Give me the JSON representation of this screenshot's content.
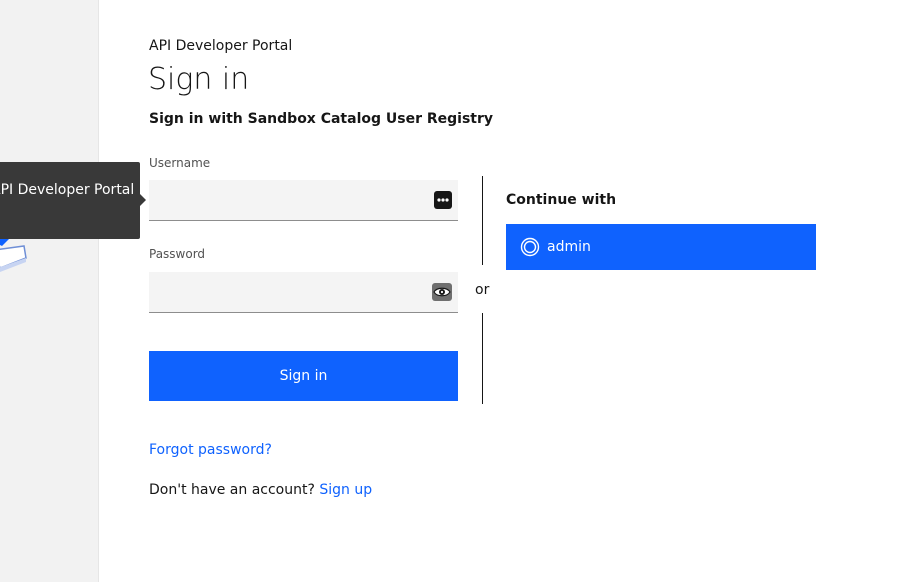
{
  "tooltip": {
    "text": "API Developer Portal"
  },
  "header": {
    "portal_label": "API Developer Portal",
    "title": "Sign in",
    "subtitle": "Sign in with Sandbox Catalog User Registry"
  },
  "form": {
    "username_label": "Username",
    "username_value": "",
    "password_label": "Password",
    "password_value": "",
    "signin_label": "Sign in",
    "forgot_label": "Forgot password?",
    "no_account_text": "Don't have an account?",
    "signup_label": "Sign up"
  },
  "divider": {
    "text": "or"
  },
  "continue": {
    "label": "Continue with",
    "providers": [
      {
        "label": "admin",
        "icon": "user-circle-icon"
      }
    ]
  },
  "icons": {
    "username_icon": "password-manager-dots-icon",
    "password_icon": "eye-icon"
  },
  "colors": {
    "primary": "#0f62fe",
    "tooltip_bg": "#393939",
    "input_bg": "#f4f4f4",
    "left_panel_bg": "#f2f2f2"
  }
}
